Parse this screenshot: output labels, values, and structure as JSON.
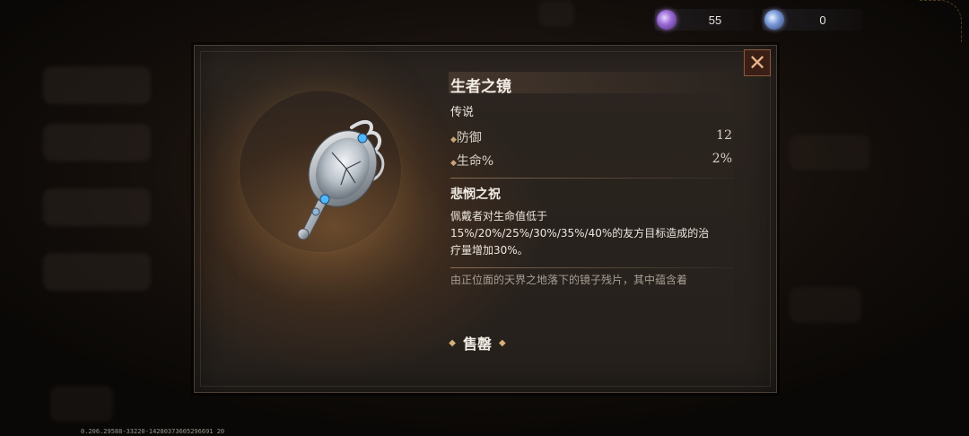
{
  "currency": {
    "gem_purple": {
      "icon": "purple-orb-icon",
      "value": "55"
    },
    "gem_blue": {
      "icon": "blue-orb-icon",
      "value": "0"
    }
  },
  "item": {
    "name": "生者之镜",
    "rarity": "传说",
    "stats": [
      {
        "label": "防御",
        "value": "12"
      },
      {
        "label": "生命%",
        "value": "2%"
      }
    ],
    "skill_name": "悲悯之祝",
    "skill_desc_lines": [
      "佩戴者对生命值低于",
      "15%/20%/25%/30%/35%/40%的友方目标造成的治",
      "疗量增加30%。"
    ],
    "lore": "由正位面的天界之地落下的镜子残片，其中蕴含着",
    "image_icon": "hand-mirror-icon"
  },
  "actions": {
    "sell_label": "售罄",
    "close_icon": "close-icon"
  },
  "footer": {
    "build": "0.206.29588-33220-14280373605296691 20"
  },
  "colors": {
    "title": "#f2ece5",
    "stat": "#d9d0c6",
    "lore": "#a89e94",
    "accent": "#d6b07a",
    "close_bg": "#3a1f17"
  }
}
